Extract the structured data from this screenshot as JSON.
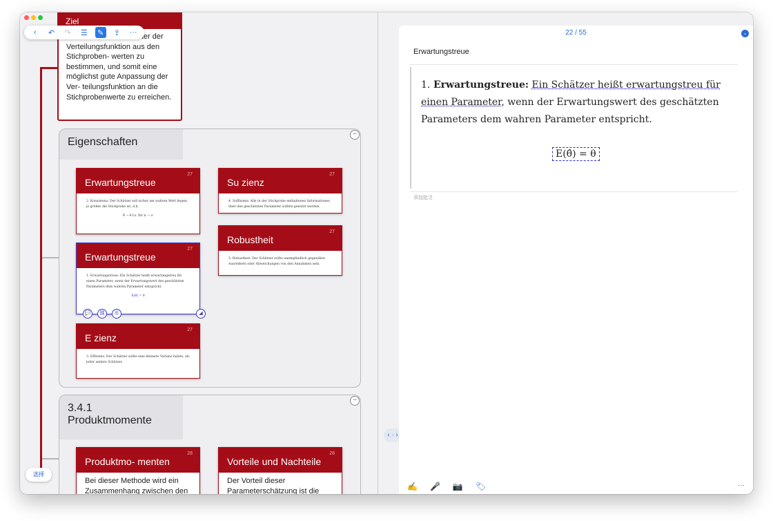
{
  "toolbar": {
    "back": "‹",
    "undo": "↶",
    "redo": "↷",
    "list": "☰",
    "edit": "✎",
    "share": "⇪",
    "more": "···"
  },
  "topcard": {
    "title": "Ziel",
    "text": "Ziel ist es, die Parameter der Verteilungsfunktion aus den Stichproben- werten zu bestimmen, und somit eine möglichst gute Anpassung der Ver- teilungsfunktion an die Stichprobenwerte zu erreichen."
  },
  "group1": {
    "label": "Eigenschaften",
    "collapse": "−",
    "cards": [
      {
        "title": "Erwartungstreue",
        "page": "27",
        "body": "2. Konsistenz: Der Schätzer soll sicher am wahren Wert liegen, je größer die Stichprobe ist, d.h.",
        "formula": "θ̂ → θ f.s.   für n → ∞"
      },
      {
        "title": "Su zienz",
        "page": "27",
        "body": "4. Suffizienz: Alle in der Stichprobe enthaltenen Informationen über den geschätzten Parameter sollten genutzt werden."
      },
      {
        "title": "Robustheit",
        "page": "27",
        "body": "5. Robustheit: Der Schätzer sollte unempfindlich gegenüber Ausreißern oder Abweichungen von den Annahmen sein."
      },
      {
        "title": "Erwartungstreue",
        "page": "27",
        "body": "1. Erwartungstreue: Ein Schätzer heißt erwartungstreu für einen Parameter, wenn der Erwartungswert des geschätzten Parameters dem wahren Parameter entspricht.",
        "formula": "E(θ̂) = θ"
      },
      {
        "title": "E zienz",
        "page": "27",
        "body": "3. Effizienz: Der Schätzer sollte eine kleinere Varianz haben, als jeder andere Schätzer."
      }
    ]
  },
  "group2": {
    "label": "3.4.1 Produktmomente",
    "collapse": "−",
    "cards": [
      {
        "title": "Produktmo- menten",
        "page": "28",
        "body": "Bei dieser Methode wird ein Zusammenhang zwischen den"
      },
      {
        "title": "Vorteile und Nachteile",
        "page": "28",
        "body": "Der Vorteil dieser Parameterschätzung ist die"
      }
    ]
  },
  "selection_dots": [
    "💬",
    "⛓",
    "☰",
    "◢"
  ],
  "pager": "‹ · ›",
  "select_button": "选择",
  "doc": {
    "page_indicator": "22 / 55",
    "chevron": "⌄",
    "title": "Erwartungstreue",
    "item_number": "1.",
    "term": "Erwartungstreue:",
    "sentence_underlined": "Ein Schätzer heißt erwartungstreu für einen Parameter",
    "sentence_rest": ", wenn der Erwartungswert des geschätzten Parameters dem wahren Parameter entspricht.",
    "formula": "E(θ̂) = θ",
    "annotation_placeholder": "添加批注",
    "bottom_icons": [
      "✍",
      "🎤",
      "📷",
      "🏷"
    ],
    "more": "···"
  }
}
